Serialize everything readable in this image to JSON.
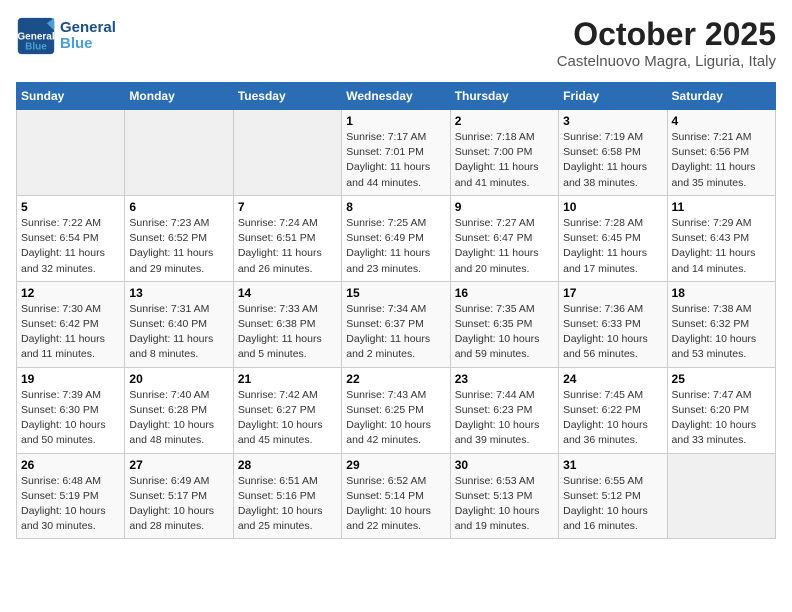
{
  "header": {
    "logo_general": "General",
    "logo_blue": "Blue",
    "title": "October 2025",
    "subtitle": "Castelnuovo Magra, Liguria, Italy"
  },
  "calendar": {
    "days_of_week": [
      "Sunday",
      "Monday",
      "Tuesday",
      "Wednesday",
      "Thursday",
      "Friday",
      "Saturday"
    ],
    "weeks": [
      [
        {
          "num": "",
          "info": ""
        },
        {
          "num": "",
          "info": ""
        },
        {
          "num": "",
          "info": ""
        },
        {
          "num": "1",
          "info": "Sunrise: 7:17 AM\nSunset: 7:01 PM\nDaylight: 11 hours and 44 minutes."
        },
        {
          "num": "2",
          "info": "Sunrise: 7:18 AM\nSunset: 7:00 PM\nDaylight: 11 hours and 41 minutes."
        },
        {
          "num": "3",
          "info": "Sunrise: 7:19 AM\nSunset: 6:58 PM\nDaylight: 11 hours and 38 minutes."
        },
        {
          "num": "4",
          "info": "Sunrise: 7:21 AM\nSunset: 6:56 PM\nDaylight: 11 hours and 35 minutes."
        }
      ],
      [
        {
          "num": "5",
          "info": "Sunrise: 7:22 AM\nSunset: 6:54 PM\nDaylight: 11 hours and 32 minutes."
        },
        {
          "num": "6",
          "info": "Sunrise: 7:23 AM\nSunset: 6:52 PM\nDaylight: 11 hours and 29 minutes."
        },
        {
          "num": "7",
          "info": "Sunrise: 7:24 AM\nSunset: 6:51 PM\nDaylight: 11 hours and 26 minutes."
        },
        {
          "num": "8",
          "info": "Sunrise: 7:25 AM\nSunset: 6:49 PM\nDaylight: 11 hours and 23 minutes."
        },
        {
          "num": "9",
          "info": "Sunrise: 7:27 AM\nSunset: 6:47 PM\nDaylight: 11 hours and 20 minutes."
        },
        {
          "num": "10",
          "info": "Sunrise: 7:28 AM\nSunset: 6:45 PM\nDaylight: 11 hours and 17 minutes."
        },
        {
          "num": "11",
          "info": "Sunrise: 7:29 AM\nSunset: 6:43 PM\nDaylight: 11 hours and 14 minutes."
        }
      ],
      [
        {
          "num": "12",
          "info": "Sunrise: 7:30 AM\nSunset: 6:42 PM\nDaylight: 11 hours and 11 minutes."
        },
        {
          "num": "13",
          "info": "Sunrise: 7:31 AM\nSunset: 6:40 PM\nDaylight: 11 hours and 8 minutes."
        },
        {
          "num": "14",
          "info": "Sunrise: 7:33 AM\nSunset: 6:38 PM\nDaylight: 11 hours and 5 minutes."
        },
        {
          "num": "15",
          "info": "Sunrise: 7:34 AM\nSunset: 6:37 PM\nDaylight: 11 hours and 2 minutes."
        },
        {
          "num": "16",
          "info": "Sunrise: 7:35 AM\nSunset: 6:35 PM\nDaylight: 10 hours and 59 minutes."
        },
        {
          "num": "17",
          "info": "Sunrise: 7:36 AM\nSunset: 6:33 PM\nDaylight: 10 hours and 56 minutes."
        },
        {
          "num": "18",
          "info": "Sunrise: 7:38 AM\nSunset: 6:32 PM\nDaylight: 10 hours and 53 minutes."
        }
      ],
      [
        {
          "num": "19",
          "info": "Sunrise: 7:39 AM\nSunset: 6:30 PM\nDaylight: 10 hours and 50 minutes."
        },
        {
          "num": "20",
          "info": "Sunrise: 7:40 AM\nSunset: 6:28 PM\nDaylight: 10 hours and 48 minutes."
        },
        {
          "num": "21",
          "info": "Sunrise: 7:42 AM\nSunset: 6:27 PM\nDaylight: 10 hours and 45 minutes."
        },
        {
          "num": "22",
          "info": "Sunrise: 7:43 AM\nSunset: 6:25 PM\nDaylight: 10 hours and 42 minutes."
        },
        {
          "num": "23",
          "info": "Sunrise: 7:44 AM\nSunset: 6:23 PM\nDaylight: 10 hours and 39 minutes."
        },
        {
          "num": "24",
          "info": "Sunrise: 7:45 AM\nSunset: 6:22 PM\nDaylight: 10 hours and 36 minutes."
        },
        {
          "num": "25",
          "info": "Sunrise: 7:47 AM\nSunset: 6:20 PM\nDaylight: 10 hours and 33 minutes."
        }
      ],
      [
        {
          "num": "26",
          "info": "Sunrise: 6:48 AM\nSunset: 5:19 PM\nDaylight: 10 hours and 30 minutes."
        },
        {
          "num": "27",
          "info": "Sunrise: 6:49 AM\nSunset: 5:17 PM\nDaylight: 10 hours and 28 minutes."
        },
        {
          "num": "28",
          "info": "Sunrise: 6:51 AM\nSunset: 5:16 PM\nDaylight: 10 hours and 25 minutes."
        },
        {
          "num": "29",
          "info": "Sunrise: 6:52 AM\nSunset: 5:14 PM\nDaylight: 10 hours and 22 minutes."
        },
        {
          "num": "30",
          "info": "Sunrise: 6:53 AM\nSunset: 5:13 PM\nDaylight: 10 hours and 19 minutes."
        },
        {
          "num": "31",
          "info": "Sunrise: 6:55 AM\nSunset: 5:12 PM\nDaylight: 10 hours and 16 minutes."
        },
        {
          "num": "",
          "info": ""
        }
      ]
    ]
  }
}
